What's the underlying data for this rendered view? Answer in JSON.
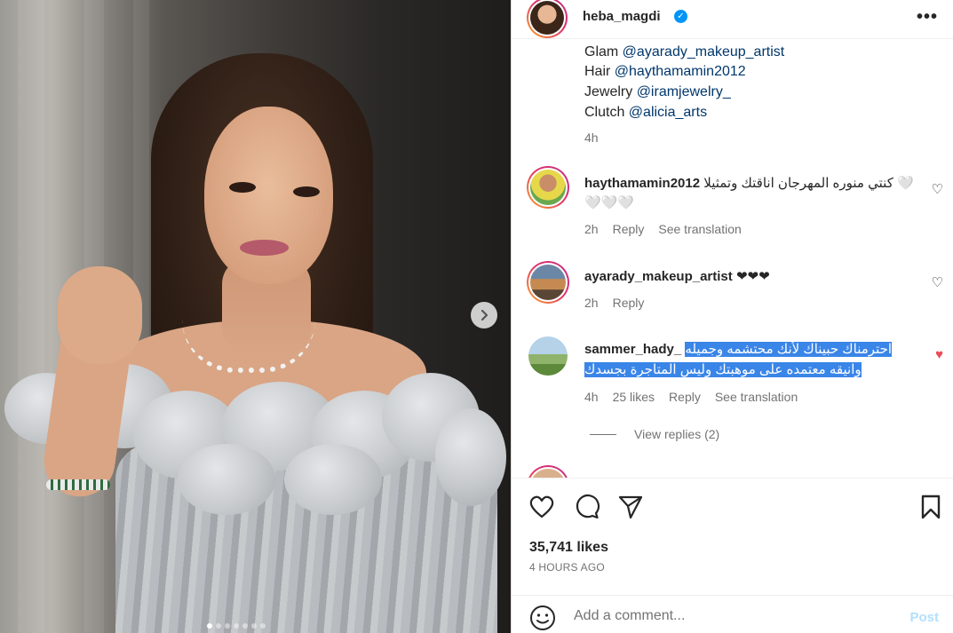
{
  "post": {
    "username": "heba_magdi",
    "verified_icon": "verified-badge-icon",
    "more_icon": "ellipsis-icon"
  },
  "caption": {
    "lines": [
      {
        "label": "Glam ",
        "mention": "@ayarady_makeup_artist"
      },
      {
        "label": "Hair ",
        "mention": "@haythamamin2012"
      },
      {
        "label": "Jewelry ",
        "mention": "@iramjewelry_"
      },
      {
        "label": "Clutch ",
        "mention": "@alicia_arts"
      }
    ],
    "time": "4h"
  },
  "comments": [
    {
      "username": "haythamamin2012",
      "text_line1": "كنتي منوره المهرجان اناقتك وتمثيلا 🤍",
      "text_line2": "🤍🤍🤍",
      "time": "2h",
      "reply": "Reply",
      "see_translation": "See translation"
    },
    {
      "username": "ayarady_makeup_artist",
      "text": "❤❤❤",
      "time": "2h",
      "reply": "Reply"
    },
    {
      "username": "sammer_hady_",
      "text_line1": "احترمناك حبيناك لأنك محتشمه وجميله",
      "text_line2": "وانيقه معتمده على موهبتك وليس المتاجرة بجسدك",
      "time": "4h",
      "likes": "25 likes",
      "reply": "Reply",
      "see_translation": "See translation",
      "view_replies": "View replies (2)",
      "liked": true
    }
  ],
  "actions": {
    "like_icon": "heart-icon",
    "comment_icon": "comment-bubble-icon",
    "share_icon": "paper-plane-icon",
    "save_icon": "bookmark-icon"
  },
  "likes": "35,741 likes",
  "timestamp": "4 HOURS AGO",
  "add_comment": {
    "placeholder": "Add a comment...",
    "post_label": "Post",
    "emoji_icon": "emoji-smile-icon"
  },
  "media": {
    "next_icon": "chevron-right-icon",
    "slide_count": 7,
    "active_slide": 1
  },
  "colors": {
    "accent": "#0095f6",
    "mention": "#00376b",
    "liked": "#ed4956",
    "selection": "#3a85e8"
  }
}
